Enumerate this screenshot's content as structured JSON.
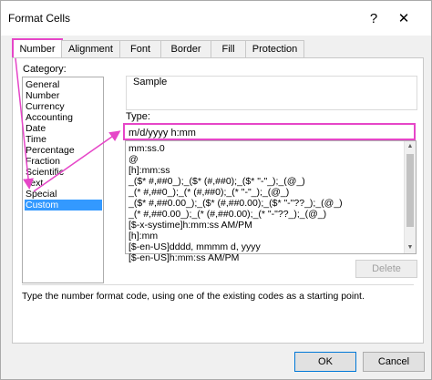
{
  "window": {
    "title": "Format Cells",
    "help_label": "?",
    "close_label": "✕"
  },
  "tabs": [
    "Number",
    "Alignment",
    "Font",
    "Border",
    "Fill",
    "Protection"
  ],
  "category": {
    "label": "Category:",
    "items": [
      "General",
      "Number",
      "Currency",
      "Accounting",
      "Date",
      "Time",
      "Percentage",
      "Fraction",
      "Scientific",
      "Text",
      "Special",
      "Custom"
    ],
    "selected": "Custom"
  },
  "sample": {
    "label": "Sample"
  },
  "type_field": {
    "label": "Type:",
    "value": "m/d/yyyy h:mm"
  },
  "formats": [
    "mm:ss.0",
    "@",
    "[h]:mm:ss",
    "_($* #,##0_);_($* (#,##0);_($* \"-\"_);_(@_)",
    "_(* #,##0_);_(* (#,##0);_(* \"-\"_);_(@_)",
    "_($* #,##0.00_);_($* (#,##0.00);_($* \"-\"??_);_(@_)",
    "_(* #,##0.00_);_(* (#,##0.00);_(* \"-\"??_);_(@_)",
    "[$-x-systime]h:mm:ss AM/PM",
    "[h]:mm",
    "[$-en-US]dddd, mmmm d, yyyy",
    "[$-en-US]h:mm:ss AM/PM"
  ],
  "delete_label": "Delete",
  "hint": "Type the number format code, using one of the existing codes as a starting point.",
  "buttons": {
    "ok": "OK",
    "cancel": "Cancel"
  },
  "colors": {
    "highlight": "#e646c8",
    "selection": "#3399ff"
  }
}
